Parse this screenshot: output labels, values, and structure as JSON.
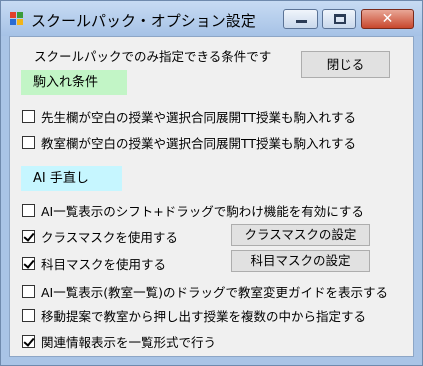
{
  "window": {
    "title": "スクールパック・オプション設定",
    "close_glyph": "✕",
    "colors": {
      "titlebar": "#a6c2e6",
      "close": "#c8472d",
      "green_label": "#c2f5c6",
      "cyan_label": "#c6f6ff"
    }
  },
  "header": {
    "note": "スクールパックでのみ指定できる条件です",
    "close_button": "閉じる"
  },
  "section1": {
    "title": "駒入れ条件",
    "options": [
      {
        "label": "先生欄が空白の授業や選択合同展開TT授業も駒入れする",
        "checked": false
      },
      {
        "label": "教室欄が空白の授業や選択合同展開TT授業も駒入れする",
        "checked": false
      }
    ]
  },
  "section2": {
    "title": "AI 手直し",
    "options": [
      {
        "label": "AI一覧表示のシフト+ドラッグで駒わけ機能を有効にする",
        "checked": false
      },
      {
        "label": "クラスマスクを使用する",
        "checked": true
      },
      {
        "label": "科目マスクを使用する",
        "checked": true
      },
      {
        "label": "AI一覧表示(教室一覧)のドラッグで教室変更ガイドを表示する",
        "checked": false
      },
      {
        "label": "移動提案で教室から押し出す授業を複数の中から指定する",
        "checked": false
      },
      {
        "label": "関連情報表示を一覧形式で行う",
        "checked": true
      }
    ],
    "class_mask_button": "クラスマスクの設定",
    "subject_mask_button": "科目マスクの設定"
  }
}
